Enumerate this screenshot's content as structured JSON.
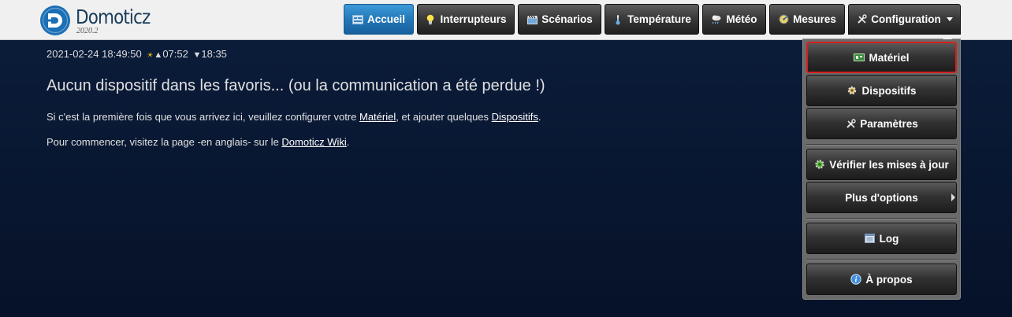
{
  "brand": {
    "name": "Domoticz",
    "version": "2020.2",
    "logo_color": "#1b6fb5"
  },
  "nav": {
    "items": [
      {
        "label": "Accueil",
        "icon": "dashboard-icon",
        "active": true
      },
      {
        "label": "Interrupteurs",
        "icon": "lightbulb-icon"
      },
      {
        "label": "Scénarios",
        "icon": "clapperboard-icon"
      },
      {
        "label": "Température",
        "icon": "thermometer-icon"
      },
      {
        "label": "Météo",
        "icon": "weather-cloud-icon"
      },
      {
        "label": "Mesures",
        "icon": "gauge-icon"
      },
      {
        "label": "Configuration",
        "icon": "tools-icon",
        "open": true
      }
    ]
  },
  "status": {
    "datetime": "2021-02-24 18:49:50",
    "sunrise": "07:52",
    "sunset": "18:35"
  },
  "main": {
    "no_favorites_title": "Aucun dispositif dans les favoris... (ou la communication a été perdue !)",
    "line1_prefix": "Si c'est la première fois que vous arrivez ici, veuillez configurer votre ",
    "line1_link1": "Matériel",
    "line1_middle": ", et ajouter quelques ",
    "line1_link2": "Dispositifs",
    "line1_suffix": ".",
    "line2_prefix": "Pour commencer, visitez la page -en anglais- sur le ",
    "line2_link": "Domoticz Wiki",
    "line2_suffix": "."
  },
  "config_menu": {
    "items": [
      {
        "label": "Matériel",
        "icon": "hardware-board-icon",
        "highlighted": true
      },
      {
        "label": "Dispositifs",
        "icon": "gear-sun-icon"
      },
      {
        "label": "Paramètres",
        "icon": "tools-icon"
      },
      {
        "label": "Vérifier les mises à jour",
        "icon": "update-gear-icon"
      },
      {
        "label": "Plus d'options",
        "icon": "",
        "submenu": true
      },
      {
        "label": "Log",
        "icon": "log-list-icon"
      },
      {
        "label": "À propos",
        "icon": "info-icon"
      }
    ]
  },
  "colors": {
    "accent_active": "#2478b8",
    "highlight_border": "#d42020",
    "background": "#0a1a36"
  }
}
